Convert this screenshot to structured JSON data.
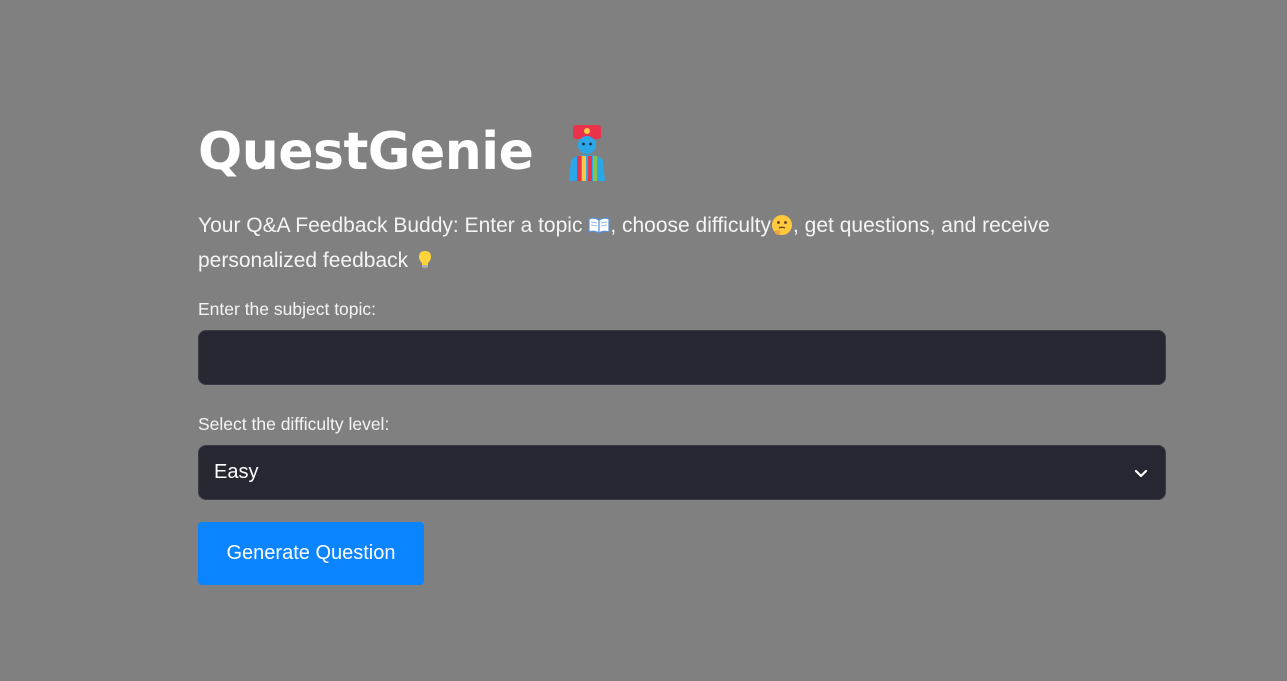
{
  "header": {
    "title": "QuestGenie",
    "title_icon": "genie-icon"
  },
  "subtitle": {
    "part1": "Your Q&A Feedback Buddy: Enter a topic",
    "icon1": "open-book-icon",
    "part2": ", choose difficulty",
    "icon2": "thinking-face-icon",
    "part3": ", get questions, and receive personalized feedback",
    "icon3": "light-bulb-icon"
  },
  "topic": {
    "label": "Enter the subject topic:",
    "value": "",
    "placeholder": ""
  },
  "difficulty": {
    "label": "Select the difficulty level:",
    "selected": "Easy"
  },
  "actions": {
    "generate_label": "Generate Question"
  },
  "colors": {
    "background": "#808080",
    "input_bg": "#262730",
    "button_bg": "#0a84ff"
  }
}
